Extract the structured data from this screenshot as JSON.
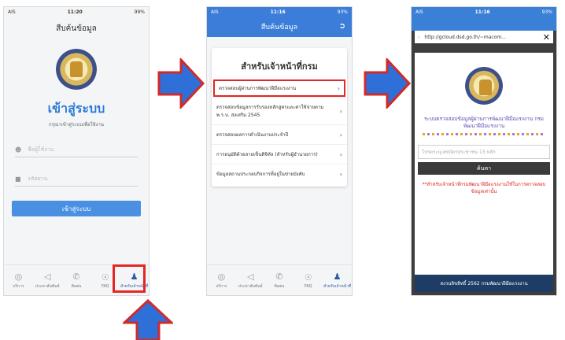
{
  "screen1": {
    "status": {
      "left": "AIS",
      "time": "11:20",
      "battery": "99%"
    },
    "title": "สืบค้นข้อมูล",
    "login_heading": "เข้าสู่ระบบ",
    "login_sub": "กรุณาเข้าสู่ระบบเพื่อใช้งาน",
    "username_placeholder": "ชื่อผู้ใช้งาน",
    "password_placeholder": "รหัสผ่าน",
    "login_button": "เข้าสู่ระบบ",
    "tabs": [
      "บริการ",
      "ประชาสัมพันธ์",
      "ติดต่อ",
      "FAQ",
      "สำหรับเจ้าหน้าที่"
    ]
  },
  "screen2": {
    "status": {
      "left": "AIS",
      "time": "11:16",
      "battery": "93%"
    },
    "header": "สืบค้นข้อมูล",
    "card_title": "สำหรับเจ้าหน้าที่กรม",
    "menu": [
      "ตรวจสอบผู้ผ่านการพัฒนาฝีมือแรงงาน",
      "ตรวจสอบข้อมูลการรับรองหลักสูตรและค่าใช้จ่ายตาม พ.ร.บ. ส่งเสริม 2545",
      "ตรวจสอบผลการดำเนินงานประจำปี",
      "การอนุมัติด้วยลายเซ็นดิจิทัล (สำหรับผู้อำนวยการ)",
      "ข้อมูลสถานประกอบกิจการที่อยู่ในข่ายบังคับ"
    ],
    "tabs": [
      "บริการ",
      "ประชาสัมพันธ์",
      "ติดต่อ",
      "FAQ",
      "สำหรับเจ้าหน้าที่"
    ]
  },
  "screen3": {
    "status": {
      "left": "AIS",
      "time": "11:16",
      "battery": "93%"
    },
    "url": "http://gcloud.dsd.go.th/~macom...",
    "system_title": "ระบบตรวจสอบข้อมูลผู้ผ่านการพัฒนาฝีมือแรงงาน กรมพัฒนาฝีมือแรงงาน",
    "id_placeholder": "โปรดระบุเลขบัตรประชาชน 13 หลัก",
    "search_button": "ค้นหา",
    "note": "**สำหรับเจ้าหน้าที่กรมพัฒนาฝีมือแรงงานใช้ในการตรวจสอบข้อมูลเท่านั้น",
    "footer": "สงวนลิขสิทธิ์ 2562 กรมพัฒนาฝีมือแรงงาน"
  },
  "colors": {
    "arrow_fill": "#2e6fd8",
    "arrow_border": "#d12a2a",
    "highlight": "#e32626",
    "primary": "#3b7dd8"
  }
}
